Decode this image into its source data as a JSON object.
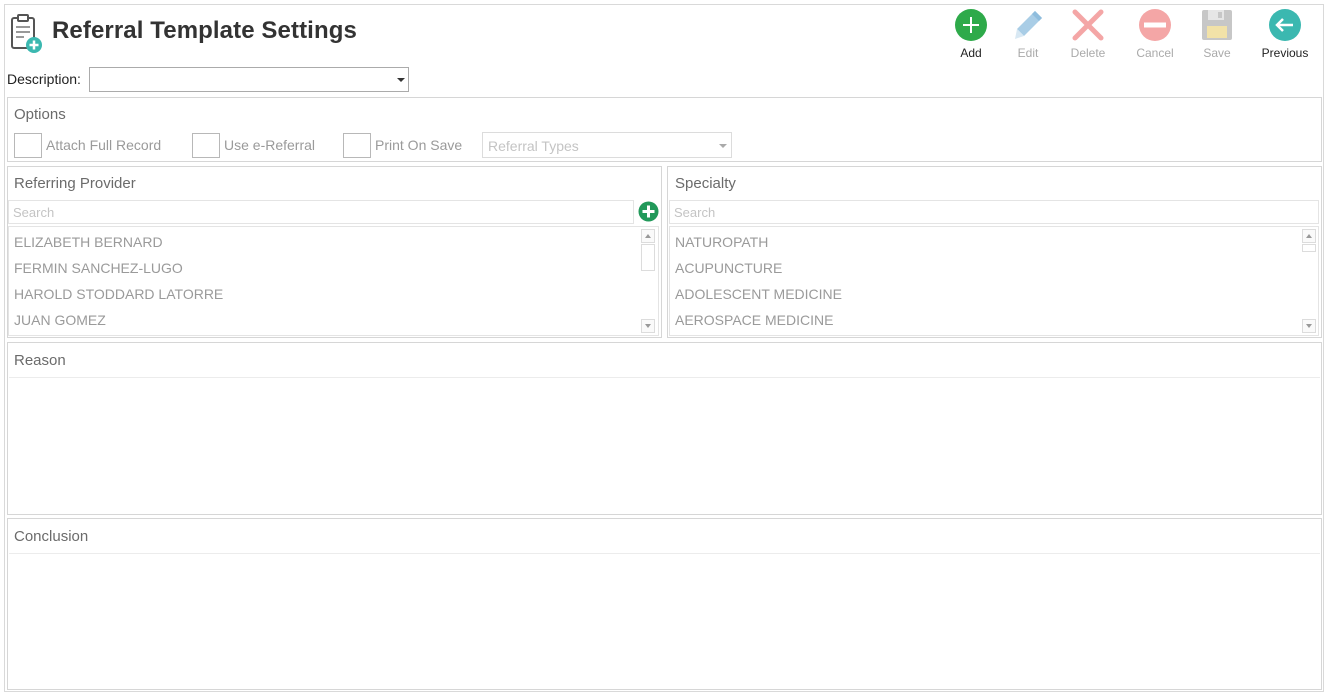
{
  "header": {
    "title": "Referral Template Settings",
    "icon": "clipboard-add-icon"
  },
  "toolbar": {
    "add": "Add",
    "edit": "Edit",
    "delete": "Delete",
    "cancel": "Cancel",
    "save": "Save",
    "previous": "Previous"
  },
  "description": {
    "label": "Description:",
    "value": ""
  },
  "options": {
    "title": "Options",
    "attach_full_record": "Attach Full Record",
    "use_e_referral": "Use e-Referral",
    "print_on_save": "Print On Save",
    "referral_types_placeholder": "Referral Types"
  },
  "referring_provider": {
    "title": "Referring Provider",
    "search_placeholder": "Search",
    "items": [
      "ELIZABETH BERNARD",
      "FERMIN SANCHEZ-LUGO",
      "HAROLD STODDARD LATORRE",
      "JUAN GOMEZ"
    ]
  },
  "specialty": {
    "title": "Specialty",
    "search_placeholder": "Search",
    "items": [
      "NATUROPATH",
      "ACUPUNCTURE",
      "ADOLESCENT MEDICINE",
      "AEROSPACE MEDICINE"
    ]
  },
  "reason": {
    "title": "Reason",
    "value": ""
  },
  "conclusion": {
    "title": "Conclusion",
    "value": ""
  },
  "colors": {
    "add_green": "#2eaa4a",
    "previous_teal": "#3bb8b0",
    "edit_blue": "#a9cde6",
    "delete_red": "#f4a6a6",
    "save_gray": "#c7c7c7",
    "provider_add_green": "#22995a"
  }
}
